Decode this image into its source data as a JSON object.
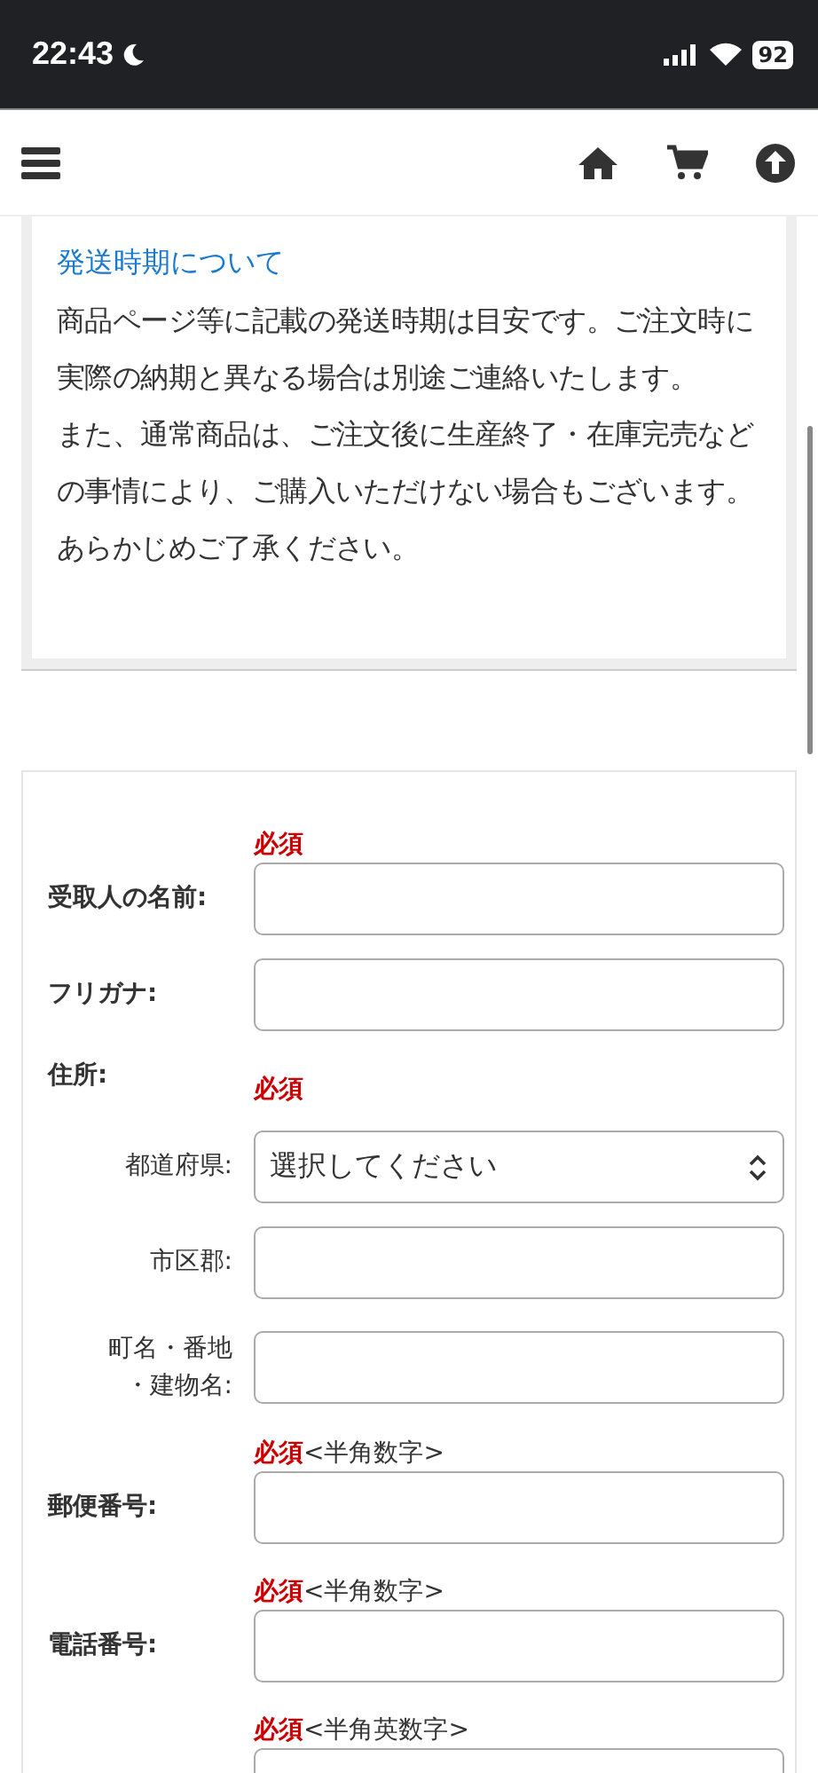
{
  "status_bar": {
    "time": "22:43",
    "battery": "92"
  },
  "notice": {
    "title": "発送時期について",
    "paragraphs": [
      "商品ページ等に記載の発送時期は目安です。ご注文時に実際の納期と異なる場合は別途ご連絡いたします。",
      "また、通常商品は、ご注文後に生産終了・在庫完売などの事情により、ご購入いただけない場合もございます。あらかじめご了承ください。"
    ]
  },
  "form": {
    "fields": [
      {
        "kind": "text",
        "label": "受取人の名前:",
        "required": "必須"
      },
      {
        "kind": "text",
        "label": "フリガナ:"
      },
      {
        "kind": "section",
        "label": "住所:",
        "required": "必須",
        "children": [
          {
            "kind": "select",
            "label": "都道府県:",
            "value": "選択してください"
          },
          {
            "kind": "text",
            "label": "市区郡:"
          },
          {
            "kind": "text",
            "label": "町名・番地・建物名:"
          }
        ]
      },
      {
        "kind": "text",
        "label": "郵便番号:",
        "required": "必須",
        "hint": "<半角数字>"
      },
      {
        "kind": "text",
        "label": "電話番号:",
        "required": "必須",
        "hint": "<半角数字>"
      },
      {
        "kind": "text",
        "required": "必須",
        "hint": "<半角英数字>"
      }
    ]
  }
}
